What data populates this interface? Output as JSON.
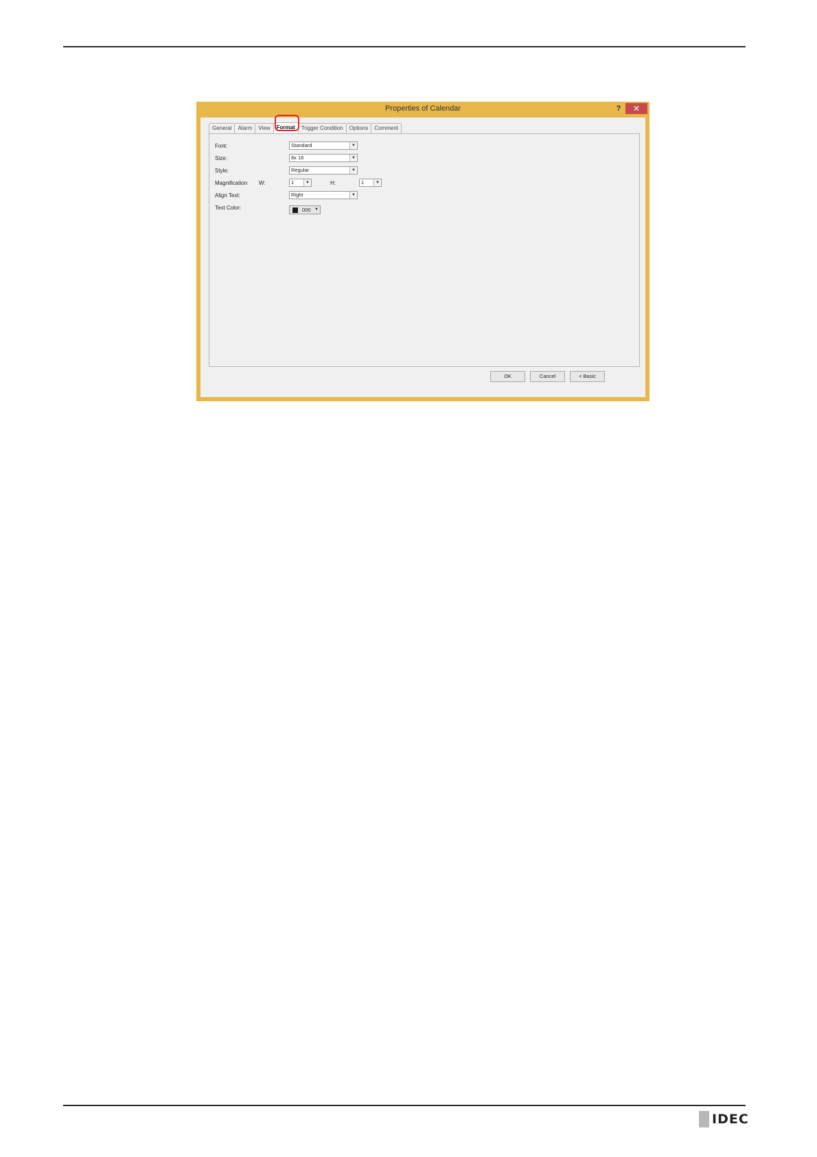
{
  "dialog": {
    "title": "Properties of Calendar",
    "help_label": "?",
    "close_label": "✕",
    "tabs": [
      "General",
      "Alarm",
      "View",
      "Format",
      "Trigger Condition",
      "Options",
      "Comment"
    ],
    "active_tab": "Format",
    "fields": {
      "font": {
        "label": "Font:",
        "value": "Standard"
      },
      "size": {
        "label": "Size:",
        "value": "8x 16"
      },
      "style": {
        "label": "Style:",
        "value": "Regular"
      },
      "magnification": {
        "label": "Magnification",
        "w_label": "W:",
        "w_value": "1",
        "h_label": "H:",
        "h_value": "1"
      },
      "align_text": {
        "label": "Align Text:",
        "value": "Right"
      },
      "text_color": {
        "label": "Text Color:",
        "value": "000",
        "swatch": "#1a1a1a"
      }
    },
    "buttons": {
      "ok": "OK",
      "cancel": "Cancel",
      "basic": "< Basic"
    }
  },
  "footer": {
    "logo": "IDEC"
  },
  "colors": {
    "frame": "#e8b74a",
    "close": "#c74a4a",
    "highlight": "#e0282e"
  }
}
